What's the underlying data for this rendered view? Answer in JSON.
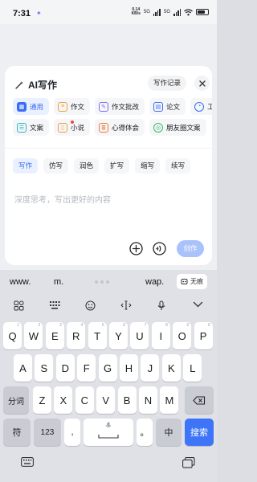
{
  "status_bar": {
    "time": "7:31",
    "net_speed_value": "0.14",
    "net_speed_unit": "KB/s",
    "signal_1": "5G",
    "signal_2": "5G",
    "battery_level": 0.6
  },
  "card": {
    "title": "AI写作",
    "history_label": "写作记录",
    "categories_row1": [
      {
        "label": "通用",
        "icon": "grid-icon",
        "color": "#3b6cf6",
        "active": true
      },
      {
        "label": "作文",
        "icon": "essay-icon",
        "color": "#f29b38"
      },
      {
        "label": "作文批改",
        "icon": "correction-icon",
        "color": "#7c6cf6"
      },
      {
        "label": "论文",
        "icon": "paper-icon",
        "color": "#3b6cf6"
      },
      {
        "label": "工作",
        "icon": "work-icon",
        "color": "#3b6cf6"
      }
    ],
    "categories_row2": [
      {
        "label": "文案",
        "icon": "copy-icon",
        "color": "#2cb6c4"
      },
      {
        "label": "小说",
        "icon": "novel-icon",
        "color": "#f29b38",
        "badge": true
      },
      {
        "label": "心得体会",
        "icon": "reflection-icon",
        "color": "#f2783a"
      },
      {
        "label": "朋友圈文案",
        "icon": "moments-icon",
        "color": "#3cb86b"
      }
    ],
    "styles": [
      "写作",
      "仿写",
      "润色",
      "扩写",
      "缩写",
      "续写"
    ],
    "prompt_placeholder": "深度思考，写出更好的内容",
    "create_label": "创作"
  },
  "keyboard": {
    "suggestions": [
      "www.",
      "m.",
      "wap."
    ],
    "incognito_label": "无痕",
    "row1": [
      "Q",
      "W",
      "E",
      "R",
      "T",
      "Y",
      "U",
      "I",
      "O",
      "P"
    ],
    "row1_sub": [
      "1",
      "2",
      "3",
      "4",
      "5",
      "6",
      "7",
      "8",
      "9",
      "0"
    ],
    "row2": [
      "A",
      "S",
      "D",
      "F",
      "G",
      "H",
      "J",
      "K",
      "L"
    ],
    "row3": [
      "Z",
      "X",
      "C",
      "V",
      "B",
      "N",
      "M"
    ],
    "segment_label": "分词",
    "symbol_label": "符",
    "num_label": "123",
    "comma": ",",
    "period": "。",
    "lang_label": "中",
    "search_label": "搜索"
  }
}
